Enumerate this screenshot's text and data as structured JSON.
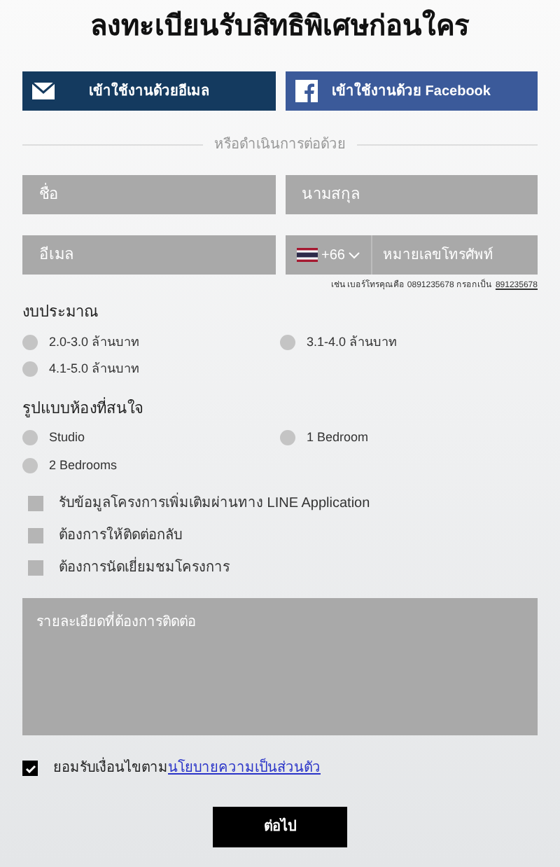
{
  "title": "ลงทะเบียนรับสิทธิพิเศษก่อนใคร",
  "login_buttons": [
    {
      "kind": "email",
      "label": "เข้าใช้งานด้วยอีเมล"
    },
    {
      "kind": "facebook",
      "label": "เข้าใช้งานด้วย Facebook"
    }
  ],
  "divider_text": "หรือดำเนินการต่อด้วย",
  "fields": {
    "first_name": {
      "placeholder": "ชื่อ"
    },
    "last_name": {
      "placeholder": "นามสกุล"
    },
    "email": {
      "placeholder": "อีเมล"
    },
    "phone": {
      "country_code": "+66",
      "placeholder": "หมายเลขโทรศัพท์"
    }
  },
  "phone_hint": {
    "text": "เช่น เบอร์โทรคุณคือ 0891235678 กรอกเป็น",
    "example": "891235678"
  },
  "budget": {
    "label": "งบประมาณ",
    "options": [
      {
        "label": "2.0-3.0 ล้านบาท",
        "selected": false
      },
      {
        "label": "3.1-4.0 ล้านบาท",
        "selected": false
      },
      {
        "label": "4.1-5.0 ล้านบาท",
        "selected": false
      }
    ]
  },
  "room_type": {
    "label": "รูปแบบห้องที่สนใจ",
    "options": [
      {
        "label": "Studio",
        "selected": false
      },
      {
        "label": "1 Bedroom",
        "selected": false
      },
      {
        "label": "2 Bedrooms",
        "selected": false
      }
    ]
  },
  "options": [
    {
      "label": "รับข้อมูลโครงการเพิ่มเติมผ่านทาง LINE Application",
      "checked": false
    },
    {
      "label": "ต้องการให้ติดต่อกลับ",
      "checked": false
    },
    {
      "label": "ต้องการนัดเยี่ยมชมโครงการ",
      "checked": false
    }
  ],
  "details": {
    "placeholder": "รายละเอียดที่ต้องการติดต่อ"
  },
  "consent": {
    "checked": true,
    "text": "ยอมรับเงื่อนไขตาม",
    "link": "นโยบายความเป็นส่วนตัว"
  },
  "submit": "ต่อไป"
}
